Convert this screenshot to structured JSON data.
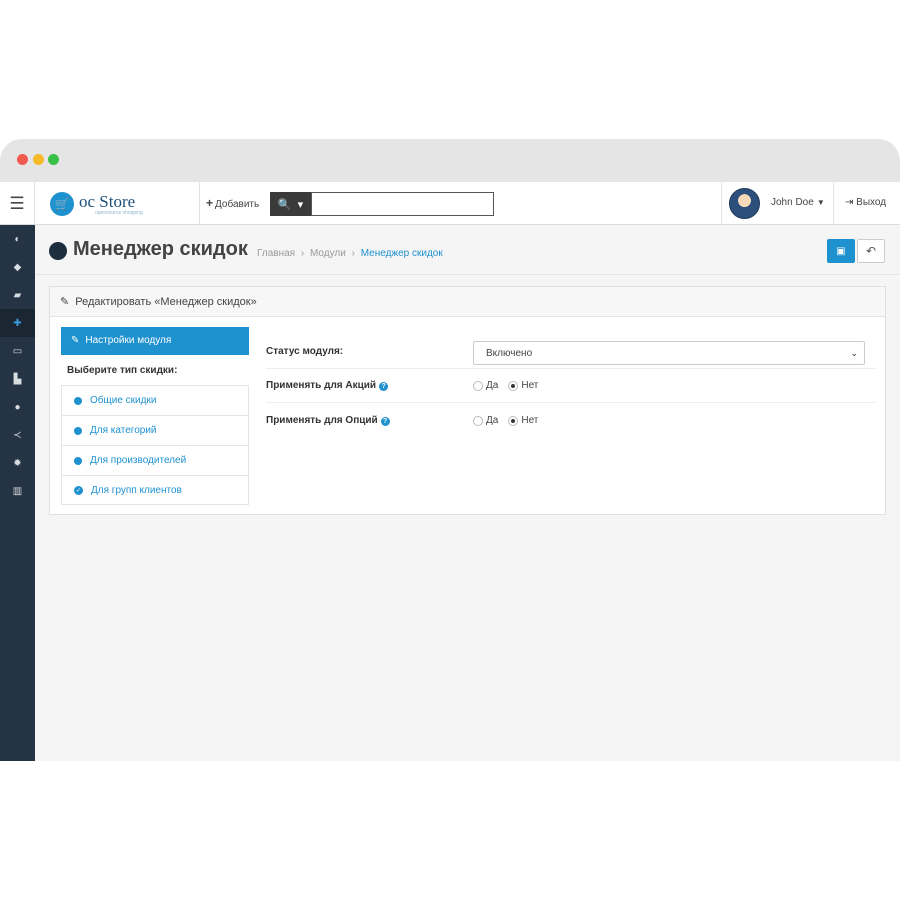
{
  "topbar": {
    "logo_text": "oc Store",
    "logo_tag": "opensource shopping",
    "add_label": "Добавить",
    "search_value": "",
    "user_name": "John Doe",
    "logout_label": "Выход"
  },
  "sidebar": {
    "items": [
      {
        "icon": "dashboard-icon"
      },
      {
        "icon": "tag-icon"
      },
      {
        "icon": "book-icon"
      },
      {
        "icon": "puzzle-icon",
        "active": true
      },
      {
        "icon": "monitor-icon"
      },
      {
        "icon": "cart-icon"
      },
      {
        "icon": "user-icon"
      },
      {
        "icon": "share-icon"
      },
      {
        "icon": "gear-icon"
      },
      {
        "icon": "chart-icon"
      }
    ]
  },
  "header": {
    "title": "Менеджер скидок",
    "breadcrumb": [
      "Главная",
      "Модули",
      "Менеджер скидок"
    ]
  },
  "panel": {
    "title": "Редактировать «Менеджер скидок»",
    "tabs": {
      "active": "Настройки модуля",
      "heading": "Выберите тип скидки:",
      "items": [
        "Общие скидки",
        "Для категорий",
        "Для производителей",
        "Для групп клиентов"
      ]
    },
    "form": {
      "status_label": "Статус модуля:",
      "status_value": "Включено",
      "specials_label": "Применять для Акций",
      "options_label": "Применять для Опций",
      "yes": "Да",
      "no": "Нет",
      "specials_selected": "Нет",
      "options_selected": "Нет"
    }
  },
  "colors": {
    "accent": "#1e91cf",
    "sidebar": "#243444"
  }
}
